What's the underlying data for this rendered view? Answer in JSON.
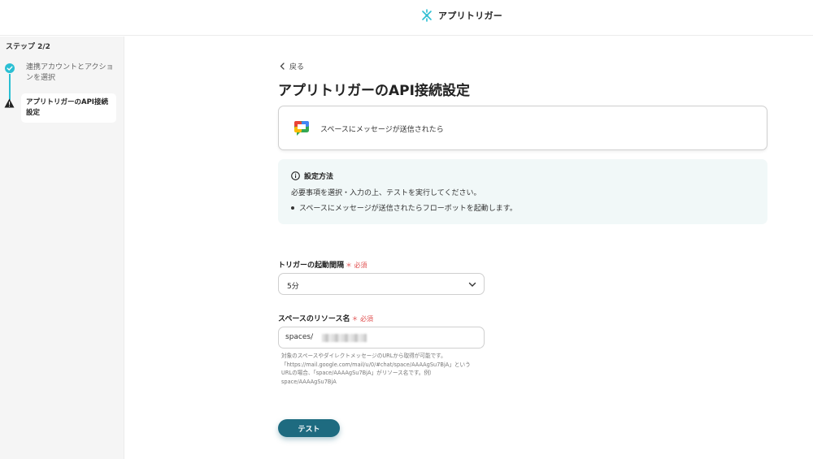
{
  "app": {
    "brand": "アプリトリガー"
  },
  "sidebar": {
    "step_count": "ステップ 2/2",
    "steps": [
      {
        "label": "連携アカウントとアクションを選択",
        "status": "completed"
      },
      {
        "label": "アプリトリガーのAPI接続設定",
        "status": "current"
      }
    ]
  },
  "main": {
    "back_label": "戻る",
    "title": "アプリトリガーのAPI接続設定",
    "trigger_card": {
      "text": "スペースにメッセージが送信されたら",
      "icon": "google-chat-icon"
    },
    "info": {
      "heading": "設定方法",
      "description": "必要事項を選択・入力の上、テストを実行してください。",
      "bullets": [
        "スペースにメッセージが送信されたらフローボットを起動します。"
      ]
    },
    "fields": {
      "interval": {
        "label": "トリガーの起動間隔",
        "required": "＊ 必須",
        "value": "5分"
      },
      "resource": {
        "label": "スペースのリソース名",
        "required": "＊ 必須",
        "value": "spaces/",
        "help": [
          "対象のスペースやダイレクトメッセージのURLから取得が可能です。",
          "「https://mail.google.com/mail/u/0/#chat/space/AAAAgSu7BjA」という",
          "URLの場合、「space/AAAAgSu7BjA」がリソース名です。例）",
          "space/AAAAgSu7BjA"
        ]
      }
    },
    "test_button": "テスト"
  },
  "colors": {
    "accent": "#2bbfd3",
    "button": "#1e6b80",
    "required": "#e04e4e",
    "info_bg": "#f1f8f8"
  }
}
